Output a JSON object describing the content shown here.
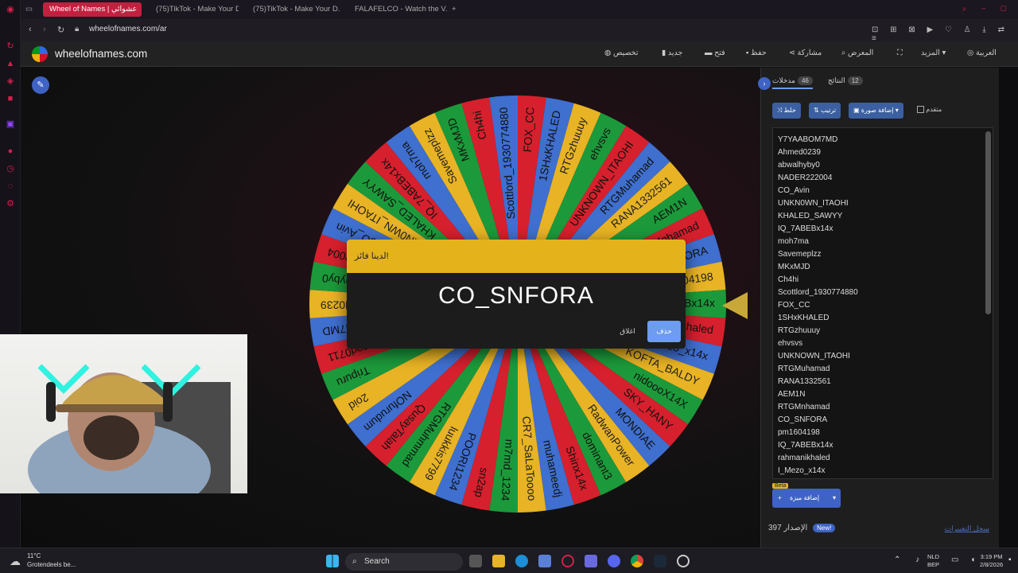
{
  "browser": {
    "tabs": [
      "Wheel of Names | عشوائي",
      "(75)TikTok - Make Your D...",
      "(75)TikTok - Make Your D...",
      "FALAFELCO - Watch the V..."
    ],
    "url": "wheelofnames.com/ar"
  },
  "app": {
    "brand": "wheelofnames.com",
    "menu": [
      "تخصيص",
      "جديد",
      "فتح",
      "حفظ",
      "مشاركة",
      "المعرض",
      "المزيد",
      "العربية"
    ]
  },
  "wheel": {
    "colors": [
      "#d6202d",
      "#3f6fcf",
      "#e8b324",
      "#1c9a3b"
    ],
    "segments": [
      "FOX_CC",
      "1SHxKHALED",
      "RTGzhuuuy",
      "ehvsvs",
      "UNKNOWN_ITAOHI",
      "RTGMuhamad",
      "RANA1332561",
      "AEM1N",
      "RTGMnhamad",
      "CO_SNFORA",
      "pm1604198",
      "IQ_7ABEBx14x",
      "rahmanikhaled",
      "I_Mezo_x14x",
      "KOFTA_BALDY",
      "nidoooX14X",
      "SKY_HANY",
      "MONDIAE",
      "RadwanPower",
      "dominant3",
      "Shinx14x",
      "muhameedj",
      "CR7_SaLaToooo",
      "m7md_1234",
      "sn2ap",
      "POORI1234",
      "luukkis7799",
      "RTGMuhmmad",
      "QusayTalah",
      "NOfurudum",
      "2oid",
      "Tripuru",
      "ssod0711",
      "M7MD",
      "Ahmed0239",
      "abwalhyby0",
      "NADER222004",
      "CO_Avin",
      "UNKN0WN_ITAOHI",
      "KHALED_SAWYY",
      "IQ_7ABEBx14x",
      "moh7ma",
      "Savemeplzz",
      "MKxMJD",
      "Ch4hi",
      "Scottlord_1930774880"
    ]
  },
  "modal": {
    "header": "لدينا فائز!",
    "winner": "CO_SNFORA",
    "remove_label": "حذف",
    "close_label": "اغلاق"
  },
  "panel": {
    "tab_entries": "مدخلات",
    "entries_count": "46",
    "tab_results": "النتائج",
    "results_count": "12",
    "shuffle_label": "خلط",
    "sort_label": "ترتيب",
    "add_image_label": "إضافة صورة",
    "advanced_label": "متقدم",
    "entries": [
      "Y7YAABOM7MD",
      "Ahmed0239",
      "abwalhyby0",
      "NADER222004",
      "CO_Avin",
      "UNKN0WN_ITAOHI",
      "KHALED_SAWYY",
      "IQ_7ABEBx14x",
      "moh7ma",
      "Savemeplzz",
      "MKxMJD",
      "Ch4hi",
      "Scottlord_1930774880",
      "FOX_CC",
      "1SHxKHALED",
      "RTGzhuuuy",
      "ehvsvs",
      "UNKNOWN_ITAOHI",
      "RTGMuhamad",
      "RANA1332561",
      "AEM1N",
      "RTGMnhamad",
      "CO_SNFORA",
      "pm1604198",
      "IQ_7ABEBx14x",
      "rahmanikhaled",
      "I_Mezo_x14x"
    ],
    "beta": "Beta",
    "add_feature_label": "إضافة ميزة",
    "version_number": "397",
    "version_label": "الإصدار",
    "new_badge": "New!",
    "changelog": "سجل التغييرات"
  },
  "taskbar": {
    "weather_temp": "11°C",
    "weather_desc": "Grotendeels be...",
    "search": "Search",
    "lang1": "NLD",
    "lang2": "BEP",
    "time": "3:19 PM",
    "date": "2/8/2026"
  }
}
